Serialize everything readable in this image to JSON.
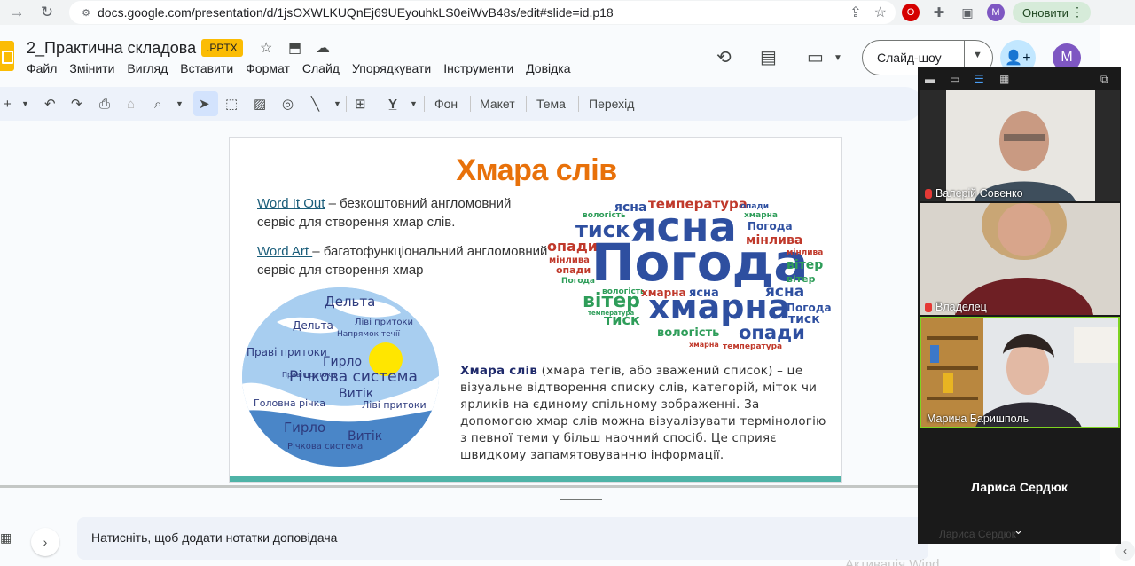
{
  "browser": {
    "url": "docs.google.com/presentation/d/1jsOXWLKUQnEj69UEyouhkLS0eiWvB48s/edit#slide=id.p18",
    "profile_initial": "M",
    "update_label": "Оновити"
  },
  "doc": {
    "title": "2_Практична складова",
    "badge": ".PPTX",
    "menu": [
      "Файл",
      "Змінити",
      "Вигляд",
      "Вставити",
      "Формат",
      "Слайд",
      "Упорядкувати",
      "Інструменти",
      "Довідка"
    ],
    "slideshow_label": "Слайд-шоу",
    "avatar_initial": "M"
  },
  "toolbar": {
    "background_label": "Фон",
    "layout_label": "Макет",
    "theme_label": "Тема",
    "transition_label": "Перехід"
  },
  "slide": {
    "title": "Хмара слів",
    "p1_link": "Word It Out",
    "p1_rest": " – безкоштовний англомовний сервіс для створення хмар слів.",
    "p2_link": "Word Art ",
    "p2_rest": "– багатофункціональний англомовний сервіс для створення хмар",
    "p3_bold": "Хмара слів",
    "p3_rest": " (хмара тегів, або зважений список) – це візуальне відтворення списку слів, категорій, міток чи ярликів на єдиному спільному зображенні. За допомогою хмар слів можна візуалізувати термінологію з певної теми у більш наочний спосіб. Це сприяє швидкому запамятовуванню інформації.",
    "cloud_words": [
      {
        "t": "температура",
        "c": "#c0392b"
      },
      {
        "t": "опади",
        "c": "#2e4fa0"
      },
      {
        "t": "ясна",
        "c": "#2e4fa0"
      },
      {
        "t": "хмарна",
        "c": "#2e9d59"
      },
      {
        "t": "вологість",
        "c": "#2e9d59"
      },
      {
        "t": "тиск",
        "c": "#2e4fa0"
      },
      {
        "t": "ясна",
        "c": "#2e4fa0"
      },
      {
        "t": "Погода",
        "c": "#2e4fa0"
      },
      {
        "t": "опади",
        "c": "#c0392b"
      },
      {
        "t": "мінлива",
        "c": "#c0392b"
      },
      {
        "t": "мінлива",
        "c": "#c0392b"
      },
      {
        "t": "опади",
        "c": "#c0392b"
      },
      {
        "t": "Погода",
        "c": "#2e4fa0"
      },
      {
        "t": "мінлива",
        "c": "#c0392b"
      },
      {
        "t": "вітер",
        "c": "#2e9d59"
      },
      {
        "t": "вітер",
        "c": "#2e9d59"
      },
      {
        "t": "Погода",
        "c": "#2e9d59"
      },
      {
        "t": "вологість",
        "c": "#2e9d59"
      },
      {
        "t": "хмарна",
        "c": "#c0392b"
      },
      {
        "t": "ясна",
        "c": "#2e4fa0"
      },
      {
        "t": "ясна",
        "c": "#2e4fa0"
      },
      {
        "t": "вітер",
        "c": "#2e9d59"
      },
      {
        "t": "температура",
        "c": "#2e9d59"
      },
      {
        "t": "хмарна",
        "c": "#2e4fa0"
      },
      {
        "t": "Погода",
        "c": "#2e4fa0"
      },
      {
        "t": "тиск",
        "c": "#2e9d59"
      },
      {
        "t": "тиск",
        "c": "#2e4fa0"
      },
      {
        "t": "вологість",
        "c": "#2e9d59"
      },
      {
        "t": "опади",
        "c": "#2e4fa0"
      },
      {
        "t": "хмарна",
        "c": "#c0392b"
      },
      {
        "t": "температура",
        "c": "#c0392b"
      }
    ],
    "globe_words": [
      "Дельта",
      "Дельта",
      "Ліві притоки",
      "Напрямок течії",
      "Праві притоки",
      "Гирло",
      "Річкова система",
      "Праві притоки",
      "Витік",
      "Головна річка",
      "Ліві притоки",
      "Гирло",
      "Витік",
      "Річкова система"
    ]
  },
  "notes": {
    "placeholder": "Натисніть, щоб додати нотатки доповідача"
  },
  "zoom": {
    "participants": [
      {
        "name": "Валерій Совенко"
      },
      {
        "name": "Владелец"
      },
      {
        "name": "Марина Баришполь"
      }
    ],
    "active_speaker": "Лариса Сердюк",
    "footer_name": "Лариса Сердюк"
  },
  "watermark": "Активація Wind"
}
